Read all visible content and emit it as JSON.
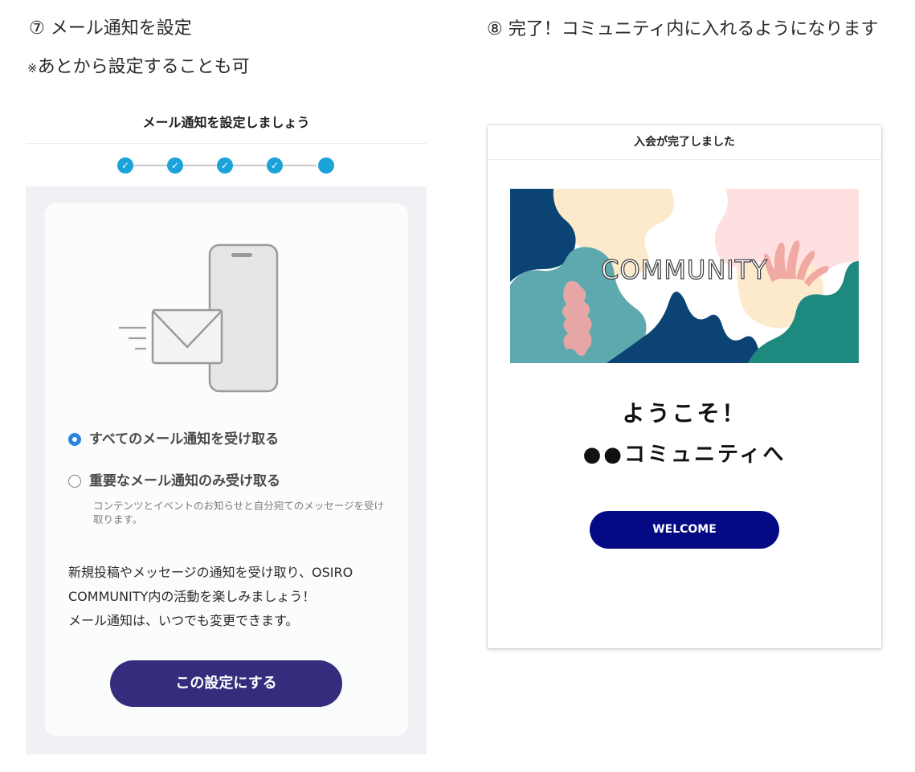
{
  "left": {
    "step_title": "⑦ メール通知を設定",
    "note_mark": "※",
    "note_text": "あとから設定することも可",
    "header_title": "メール通知を設定しましょう",
    "stepper": {
      "total": 5,
      "completed": 4,
      "check_glyph": "✓",
      "color": "#1aa2d9"
    },
    "options": [
      {
        "label": "すべてのメール通知を受け取る",
        "selected": true
      },
      {
        "label": "重要なメール通知のみ受け取る",
        "selected": false
      }
    ],
    "option_sub": "コンテンツとイベントのお知らせと自分宛てのメッセージを受け取ります。",
    "description": [
      "新規投稿やメッセージの通知を受け取り、OSIRO",
      "COMMUNITY内の活動を楽しみましょう！",
      "メール通知は、いつでも変更できます。"
    ],
    "submit_label": "この設定にする",
    "submit_color": "#342c7c",
    "illustration_icons": [
      "envelope-icon",
      "smartphone-icon"
    ]
  },
  "right": {
    "step_title": "⑧ 完了！コミュニティ内に入れるようになります",
    "header_title": "入会が完了しました",
    "banner_text": "COMMUNITY",
    "welcome_line1": "ようこそ！",
    "welcome_line2": "●●コミュニティへ",
    "welcome_button": "WELCOME",
    "welcome_button_color": "#040a84"
  }
}
